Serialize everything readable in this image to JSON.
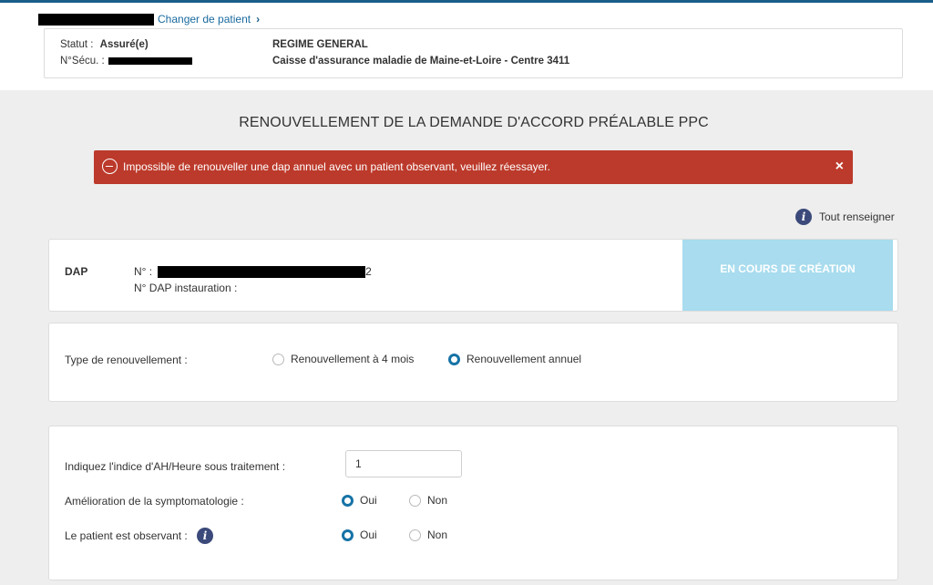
{
  "header": {
    "change_patient": "Changer de patient",
    "statut_label": "Statut :",
    "statut_value": "Assuré(e)",
    "nsecu_label": "N°Sécu. :",
    "regime": "REGIME GENERAL",
    "caisse": "Caisse d'assurance maladie de Maine-et-Loire - Centre 3411"
  },
  "page": {
    "title": "RENOUVELLEMENT DE LA DEMANDE D'ACCORD PRÉALABLE PPC"
  },
  "alert": {
    "message": "Impossible de renouveller une dap annuel avec un patient observant, veuillez réessayer.",
    "close": "×"
  },
  "fill_all": {
    "icon": "info-icon",
    "label": "Tout renseigner"
  },
  "dap": {
    "label": "DAP",
    "number_label": "N° :",
    "number_suffix": "2",
    "instauration_label": "N° DAP instauration :",
    "status": "EN COURS DE CRÉATION"
  },
  "renewal": {
    "label": "Type de renouvellement :",
    "options": [
      "Renouvellement à 4 mois",
      "Renouvellement annuel"
    ],
    "selected": "Renouvellement annuel"
  },
  "form": {
    "ah_label": "Indiquez l'indice d'AH/Heure sous traitement :",
    "ah_value": "1",
    "symptom_label": "Amélioration de la symptomatologie :",
    "symptom_selected": "Oui",
    "observant_label": "Le patient est observant :",
    "observant_selected": "Oui",
    "yes": "Oui",
    "no": "Non"
  },
  "colors": {
    "alert": "#bc3a2b",
    "status": "#a8dcee",
    "accent": "#1673a6"
  }
}
